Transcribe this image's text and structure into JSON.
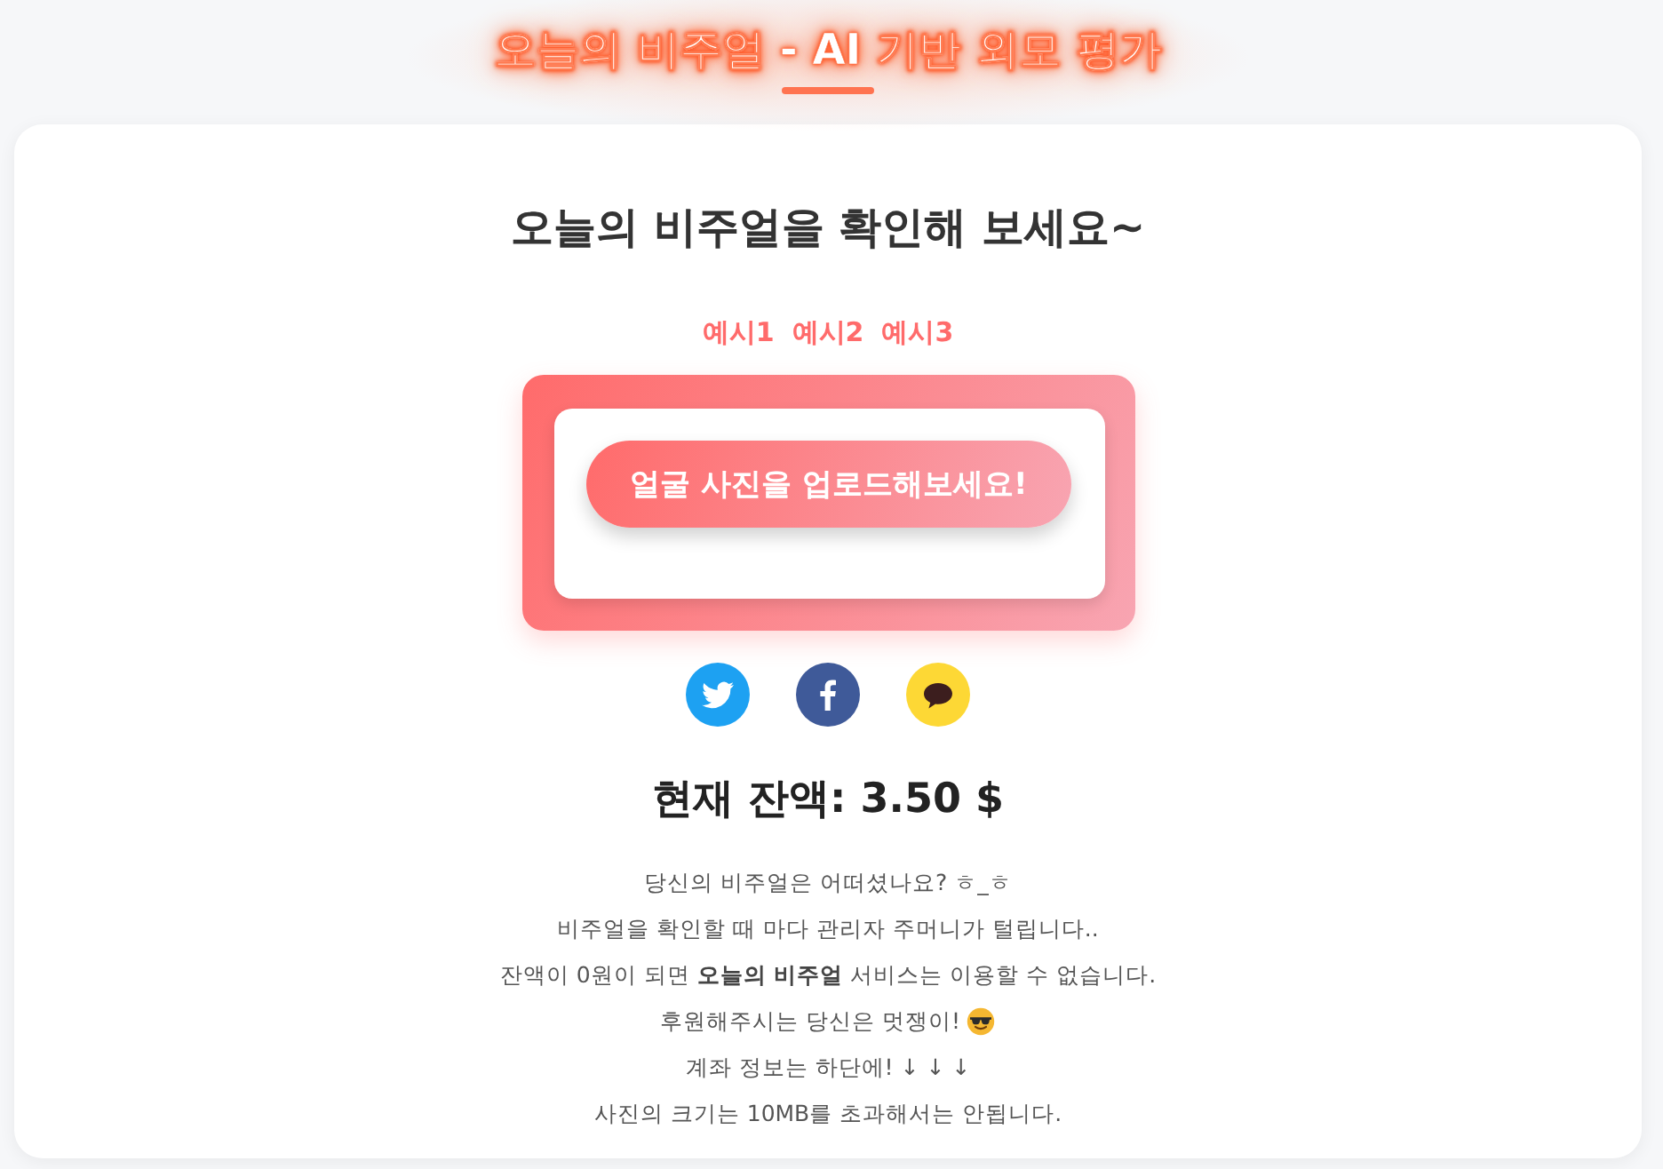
{
  "header": {
    "title": "오늘의 비주얼 - AI 기반 외모 평가"
  },
  "main": {
    "heading": "오늘의 비주얼을 확인해 보세요~",
    "examples": [
      {
        "label": "예시1"
      },
      {
        "label": "예시2"
      },
      {
        "label": "예시3"
      }
    ],
    "upload": {
      "button": "얼굴 사진을 업로드해보세요!"
    },
    "share": [
      {
        "kind": "twitter"
      },
      {
        "kind": "facebook"
      },
      {
        "kind": "kakao"
      }
    ],
    "balance": "현재 잔액: 3.50 $",
    "notice": [
      {
        "kind": "plain",
        "text": "당신의 비주얼은 어떠셨나요? ㅎ_ㅎ"
      },
      {
        "kind": "plain",
        "text": "비주얼을 확인할 때 마다 관리자 주머니가 털립니다.."
      },
      {
        "kind": "plain",
        "text": "잔액이 0원이 되면 **오늘의 비주얼** 서비스는 이용할 수 없습니다."
      },
      {
        "kind": "emoji",
        "text": "후원해주시는 당신은 멋쟁이!"
      },
      {
        "kind": "plain",
        "text": "계좌 정보는 하단에! ↓ ↓ ↓"
      },
      {
        "kind": "plain",
        "text": "사진의 크기는 10MB를 초과해서는 안됩니다."
      }
    ]
  }
}
